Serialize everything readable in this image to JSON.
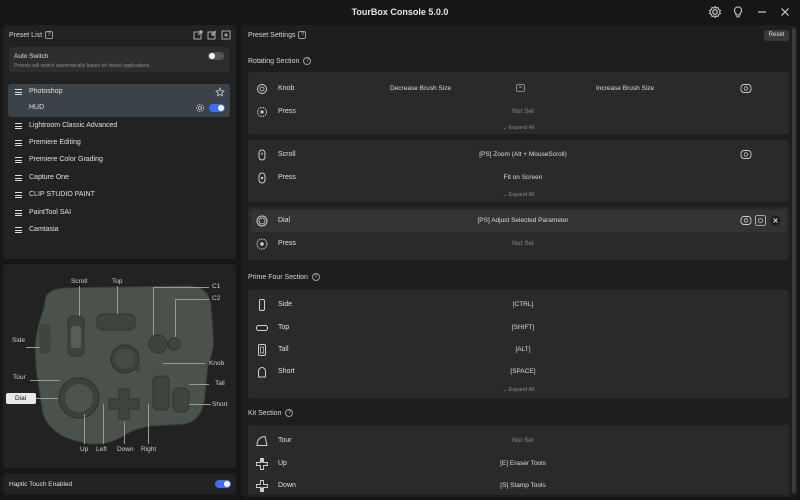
{
  "app": {
    "title": "TourBox Console 5.0.0"
  },
  "titlebar_icons": [
    "settings-icon",
    "bulb-icon",
    "minimize-icon",
    "close-icon"
  ],
  "preset_list": {
    "title": "Preset List",
    "auto_switch": {
      "label": "Auto Switch",
      "description": "Presets will switch automatically based on linked applications.",
      "enabled": false
    },
    "items": [
      {
        "label": "Photoshop",
        "selected": true
      },
      {
        "label": "HUD",
        "sub": true,
        "enabled": true
      },
      {
        "label": "Lightroom Classic Advanced"
      },
      {
        "label": "Premiere Editing"
      },
      {
        "label": "Premiere Color Grading"
      },
      {
        "label": "Capture One"
      },
      {
        "label": "CLIP STUDIO PAINT"
      },
      {
        "label": "PaintTool SAI"
      },
      {
        "label": "Camtasia"
      }
    ]
  },
  "device": {
    "labels": {
      "scroll": "Scroll",
      "top": "Top",
      "c1": "C1",
      "c2": "C2",
      "side": "Side",
      "knob": "Knob",
      "tour": "Tour",
      "tall": "Tall",
      "dial": "Dial",
      "short": "Short",
      "up": "Up",
      "left": "Left",
      "down": "Down",
      "right": "Right"
    }
  },
  "haptic": {
    "label": "Haptic Touch Enabled",
    "enabled": true
  },
  "preset_settings": {
    "title": "Preset Settings",
    "reset_label": "Reset",
    "expand_label": "Expand All",
    "rotating": {
      "title": "Rotating Section",
      "knob": {
        "name": "Knob",
        "left": "Decrease Brush Size",
        "right": "Increase Brush Size"
      },
      "knob_press": {
        "name": "Press",
        "value": "Not Set"
      },
      "scroll": {
        "name": "Scroll",
        "value": "[PS] Zoom (Alt + MouseScroll)"
      },
      "scroll_press": {
        "name": "Press",
        "value": "Fit on Screen"
      },
      "dial": {
        "name": "Dial",
        "value": "[PS] Adjust Selected Parameter"
      },
      "dial_press": {
        "name": "Press",
        "value": "Not Set"
      }
    },
    "prime": {
      "title": "Prime Four Section",
      "rows": [
        {
          "name": "Side",
          "value": "[CTRL]"
        },
        {
          "name": "Top",
          "value": "[SHIFT]"
        },
        {
          "name": "Tall",
          "value": "[ALT]"
        },
        {
          "name": "Short",
          "value": "[SPACE]"
        }
      ]
    },
    "kit": {
      "title": "Kit Section",
      "rows": [
        {
          "name": "Tour",
          "value": "Not Set"
        },
        {
          "name": "Up",
          "value": "[E] Eraser Tools"
        },
        {
          "name": "Down",
          "value": "[S] Stamp Tools"
        }
      ]
    }
  },
  "colors": {
    "accent": "#3d6ef5",
    "panel": "#222222",
    "row": "#2a2a2a",
    "selected": "#3b4248"
  }
}
